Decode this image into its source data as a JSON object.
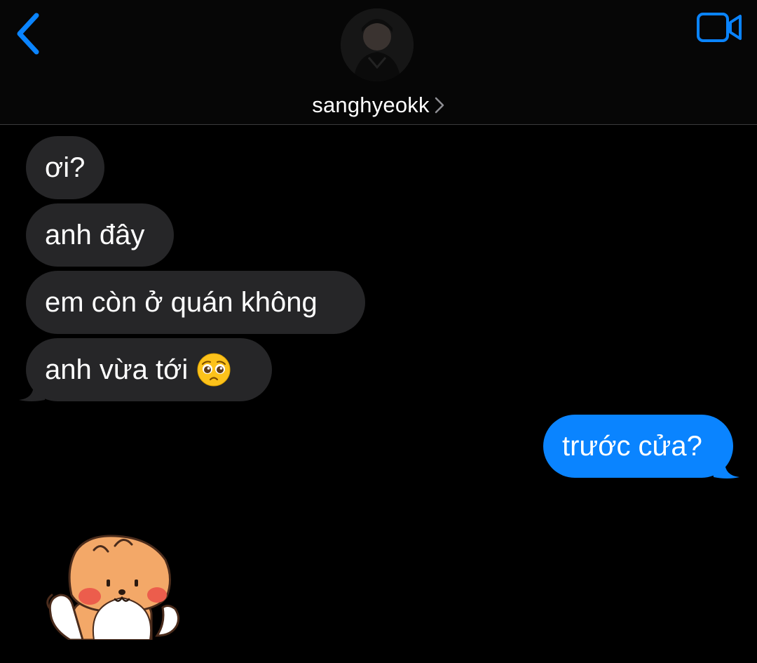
{
  "header": {
    "contact_name": "sanghyeokk",
    "accent_color": "#0a84ff",
    "icons": [
      "chevron-left-icon",
      "video-camera-icon",
      "chevron-right-icon"
    ]
  },
  "messages": [
    {
      "direction": "incoming",
      "text": "ơi?"
    },
    {
      "direction": "incoming",
      "text": "anh đây"
    },
    {
      "direction": "incoming",
      "text": "em còn ở quán không"
    },
    {
      "direction": "incoming",
      "text": "anh vừa tới",
      "emoji": "pleading-face"
    },
    {
      "direction": "outgoing",
      "text": "trước cửa?"
    }
  ],
  "sticker": {
    "icon": "fox-sticker-icon"
  },
  "colors": {
    "background": "#000000",
    "incoming_bubble": "#262628",
    "outgoing_bubble": "#0a84ff",
    "text": "#ffffff"
  }
}
